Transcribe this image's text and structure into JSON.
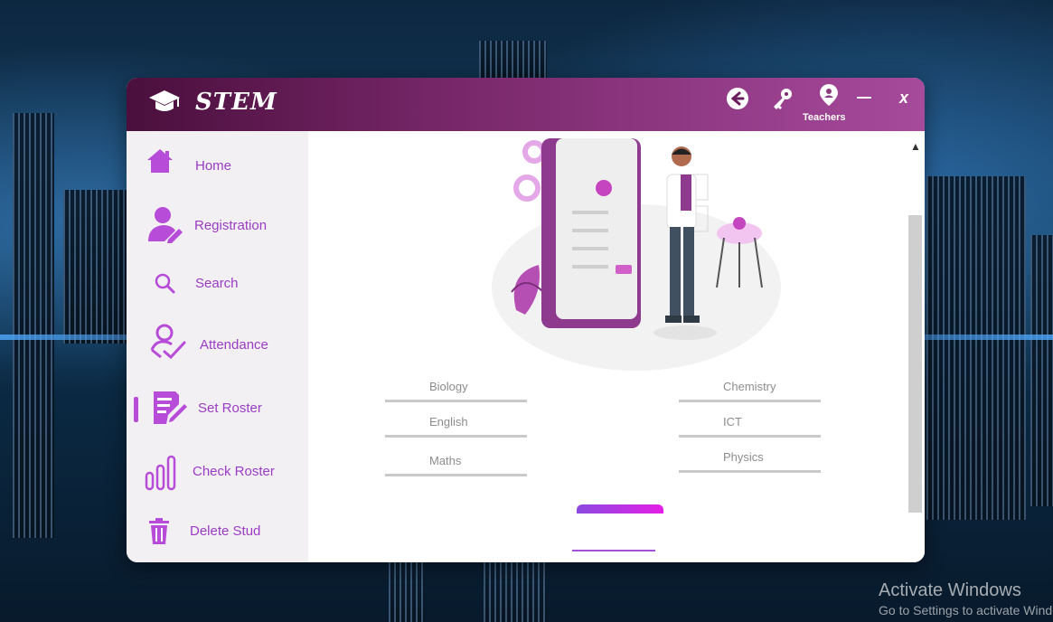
{
  "app": {
    "title": "STEM",
    "user_label": "Teachers"
  },
  "sidebar": {
    "items": [
      {
        "label": "Home",
        "icon": "home-icon"
      },
      {
        "label": "Registration",
        "icon": "user-edit-icon"
      },
      {
        "label": "Search",
        "icon": "search-icon"
      },
      {
        "label": "Attendance",
        "icon": "attendance-check-icon"
      },
      {
        "label": "Set Roster",
        "icon": "edit-document-icon",
        "active": true
      },
      {
        "label": "Check Roster",
        "icon": "bar-chart-icon"
      },
      {
        "label": "Delete Stud",
        "icon": "trash-icon"
      }
    ]
  },
  "subjects": {
    "left": [
      "Biology",
      "English",
      "Maths"
    ],
    "right": [
      "Chemistry",
      "ICT",
      "Physics"
    ]
  },
  "desktop": {
    "watermark_title": "Activate Windows",
    "watermark_subtitle": "Go to Settings to activate Windows."
  },
  "colors": {
    "accent": "#9b3cc5",
    "titlebar_start": "#4a0f3c",
    "titlebar_end": "#a64a9c",
    "button_gradient_start": "#8a4be0",
    "button_gradient_end": "#e51ee6"
  }
}
